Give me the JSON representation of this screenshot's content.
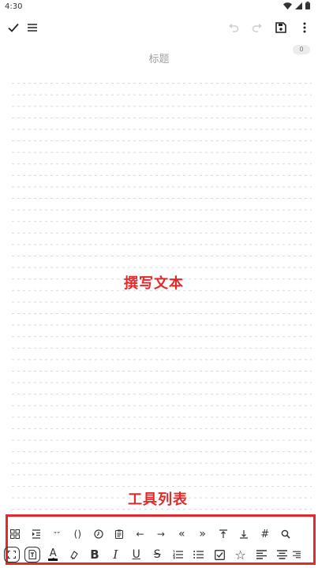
{
  "status_bar": {
    "time": "4:30"
  },
  "app_bar": {
    "icons": [
      "check-icon",
      "menu-icon",
      "undo-icon",
      "redo-icon",
      "save-icon",
      "more-vert-icon"
    ]
  },
  "editor": {
    "title_placeholder": "标题",
    "char_count": "0"
  },
  "annotations": {
    "write_text": "撰写文本",
    "toolbar_list": "工具列表"
  },
  "toolbar": {
    "row1": [
      {
        "name": "grid-icon",
        "glyph": ""
      },
      {
        "name": "indent-icon",
        "glyph": ""
      },
      {
        "name": "quote-icon",
        "glyph": "“”"
      },
      {
        "name": "parentheses-icon",
        "glyph": "()"
      },
      {
        "name": "clock-icon",
        "glyph": ""
      },
      {
        "name": "clipboard-icon",
        "glyph": ""
      },
      {
        "name": "arrow-left-icon",
        "glyph": "←"
      },
      {
        "name": "arrow-right-icon",
        "glyph": "→"
      },
      {
        "name": "double-left-icon",
        "glyph": "«"
      },
      {
        "name": "double-right-icon",
        "glyph": "»"
      },
      {
        "name": "align-top-icon",
        "glyph": "⤒"
      },
      {
        "name": "align-bottom-icon",
        "glyph": "⤓"
      },
      {
        "name": "hash-icon",
        "glyph": "#"
      },
      {
        "name": "search-icon",
        "glyph": ""
      }
    ],
    "row2": [
      {
        "name": "fullscreen-icon",
        "glyph": ""
      },
      {
        "name": "text-box-icon",
        "glyph": ""
      },
      {
        "name": "text-color-icon",
        "glyph": "A"
      },
      {
        "name": "highlighter-icon",
        "glyph": ""
      },
      {
        "name": "bold-icon",
        "glyph": "B"
      },
      {
        "name": "italic-icon",
        "glyph": "I"
      },
      {
        "name": "underline-icon",
        "glyph": "U"
      },
      {
        "name": "strikethrough-icon",
        "glyph": "S"
      },
      {
        "name": "numbered-list-icon",
        "glyph": ""
      },
      {
        "name": "bullet-list-icon",
        "glyph": ""
      },
      {
        "name": "checkbox-icon",
        "glyph": ""
      },
      {
        "name": "star-icon",
        "glyph": "☆"
      },
      {
        "name": "align-left-icon",
        "glyph": ""
      },
      {
        "name": "align-center-icon",
        "glyph": ""
      },
      {
        "name": "align-right-icon",
        "glyph": ""
      }
    ]
  },
  "colors": {
    "accent": "#e5292a",
    "text_color_bar": "#111111"
  }
}
